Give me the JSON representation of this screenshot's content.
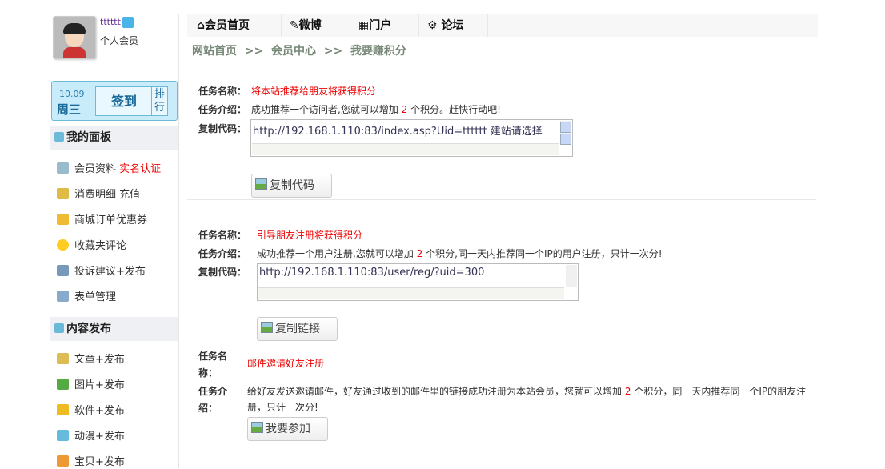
{
  "user": {
    "name": "tttttt",
    "level": "个人会员"
  },
  "signin": {
    "date": "10.09",
    "weekday": "周三",
    "button": "签到",
    "rank": "排行"
  },
  "panel1": {
    "title": "我的面板",
    "items": [
      {
        "label": "会员资料",
        "extra": "实名认证"
      },
      {
        "label": "消费明细",
        "extra": "充值"
      },
      {
        "label": "商城订单优惠券"
      },
      {
        "label": "收藏夹评论"
      },
      {
        "label": "投诉建议+发布"
      },
      {
        "label": "表单管理"
      }
    ]
  },
  "panel2": {
    "title": "内容发布",
    "items": [
      {
        "label": "文章+发布"
      },
      {
        "label": "图片+发布"
      },
      {
        "label": "软件+发布"
      },
      {
        "label": "动漫+发布"
      },
      {
        "label": "宝贝+发布"
      }
    ]
  },
  "nav": {
    "tabs": [
      "会员首页",
      "微博",
      "门户",
      "论坛"
    ]
  },
  "breadcrumb": [
    "网站首页",
    ">>",
    "会员中心",
    ">>",
    "我要赚积分"
  ],
  "labels": {
    "name": "任务名称：",
    "intro": "任务介绍：",
    "code": "复制代码：",
    "name_a": "任务名",
    "name_b": "称：",
    "intro_a": "任务介",
    "intro_b": "绍："
  },
  "tasks": [
    {
      "name": "将本站推荐给朋友将获得积分",
      "intro_pre": "成功推荐一个访问者,您就可以增加",
      "points": "2",
      "intro_post": "个积分。赶快行动吧!",
      "code": "http://192.168.1.110:83/index.asp?Uid=tttttt 建站请选择",
      "button": "复制代码"
    },
    {
      "name": "引导朋友注册将获得积分",
      "intro_pre": "成功推荐一个用户注册,您就可以增加",
      "points": "2",
      "intro_post": "个积分,同一天内推荐同一个IP的用户注册，只计一次分!",
      "code": "http://192.168.1.110:83/user/reg/?uid=300",
      "button": "复制链接"
    },
    {
      "name": "邮件邀请好友注册",
      "intro_pre": "给好友发送邀请邮件，好友通过收到的邮件里的链接成功注册为本站会员，您就可以增加",
      "points": "2",
      "intro_post": "个积分，同一天内推荐同一个IP的朋友注册，只计一次分!",
      "button": "我要参加"
    }
  ]
}
